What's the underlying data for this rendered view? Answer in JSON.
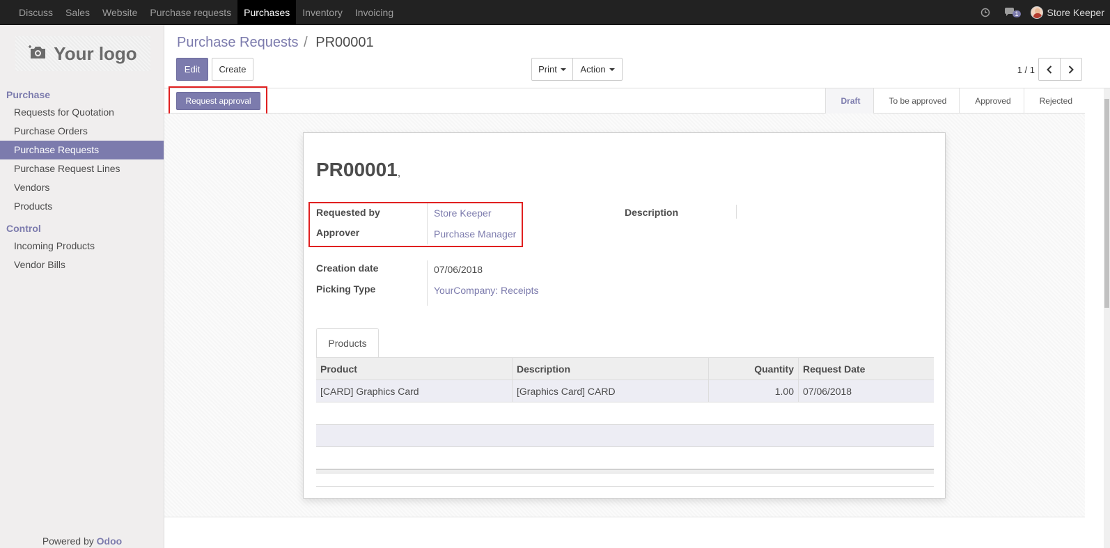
{
  "navbar": {
    "menu": [
      "Discuss",
      "Sales",
      "Website",
      "Purchase requests",
      "Purchases",
      "Inventory",
      "Invoicing"
    ],
    "active": "Purchases",
    "message_count": "1",
    "user": "Store Keeper"
  },
  "sidebar": {
    "logo_text": "Your logo",
    "section_purchase": "Purchase",
    "purchase_items": [
      "Requests for Quotation",
      "Purchase Orders",
      "Purchase Requests",
      "Purchase Request Lines",
      "Vendors",
      "Products"
    ],
    "active_item": "Purchase Requests",
    "section_control": "Control",
    "control_items": [
      "Incoming Products",
      "Vendor Bills"
    ],
    "powered_by": "Powered by",
    "powered_brand": "Odoo"
  },
  "control_panel": {
    "breadcrumb_parent": "Purchase Requests",
    "breadcrumb_separator": "/",
    "breadcrumb_current": "PR00001",
    "edit_label": "Edit",
    "create_label": "Create",
    "print_label": "Print",
    "action_label": "Action",
    "pager": "1 / 1"
  },
  "statusbar": {
    "request_approval_label": "Request approval",
    "stages": [
      "Draft",
      "To be approved",
      "Approved",
      "Rejected"
    ],
    "current_stage": "Draft"
  },
  "form": {
    "title": "PR00001",
    "title_suffix": ",",
    "requested_by_label": "Requested by",
    "requested_by": "Store Keeper",
    "approver_label": "Approver",
    "approver": "Purchase Manager",
    "description_label": "Description",
    "creation_date_label": "Creation date",
    "creation_date": "07/06/2018",
    "picking_type_label": "Picking Type",
    "picking_type": "YourCompany: Receipts",
    "tab_products": "Products",
    "table": {
      "headers": [
        "Product",
        "Description",
        "Quantity",
        "Request Date"
      ],
      "rows": [
        [
          "[CARD] Graphics Card",
          "[Graphics Card] CARD",
          "1.00",
          "07/06/2018"
        ]
      ]
    }
  },
  "colors": {
    "accent": "#7c7bad",
    "navbar_bg": "#222222",
    "highlight": "#e02020"
  }
}
